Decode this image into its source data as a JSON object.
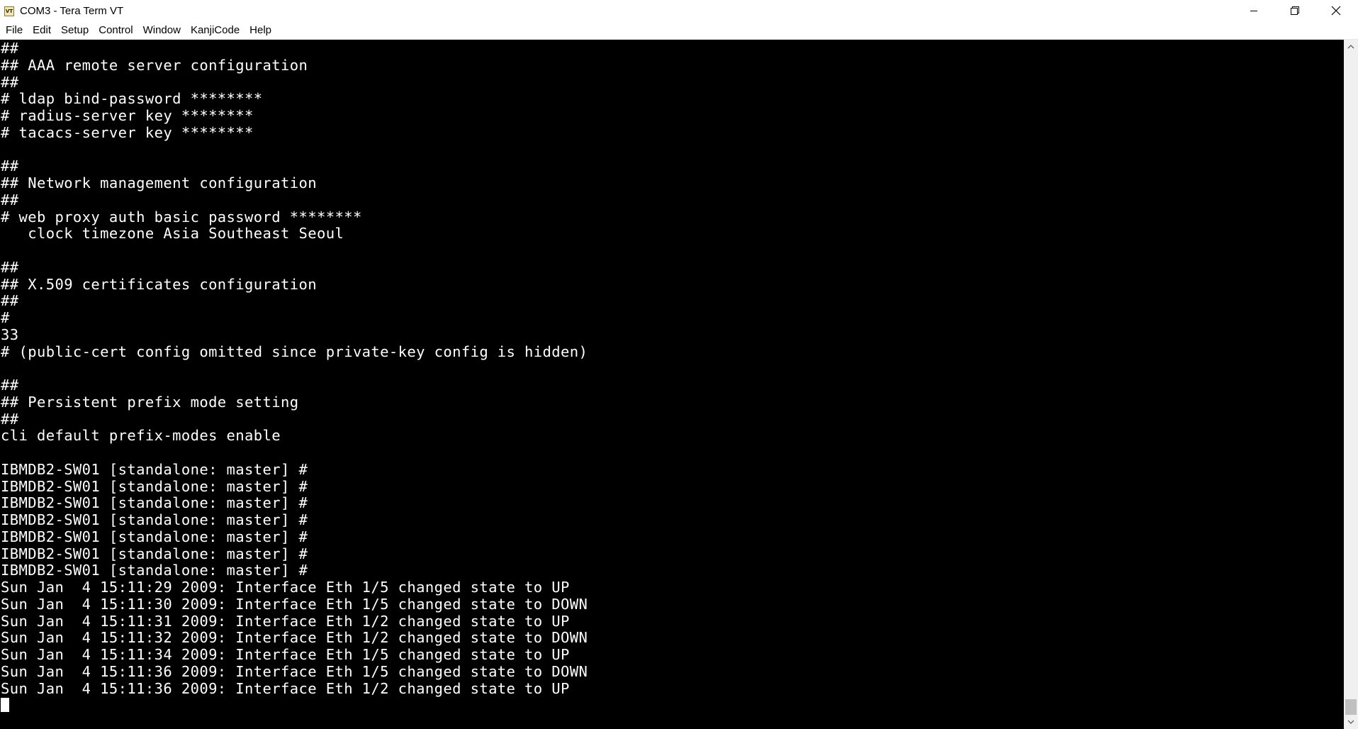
{
  "window": {
    "title": "COM3 - Tera Term VT",
    "app_icon_text": "VT"
  },
  "menu": {
    "items": [
      "File",
      "Edit",
      "Setup",
      "Control",
      "Window",
      "KanjiCode",
      "Help"
    ]
  },
  "terminal": {
    "lines": [
      "##",
      "## AAA remote server configuration",
      "##",
      "# ldap bind-password ********",
      "# radius-server key ********",
      "# tacacs-server key ********",
      "",
      "##",
      "## Network management configuration",
      "##",
      "# web proxy auth basic password ********",
      "   clock timezone Asia Southeast Seoul",
      "",
      "##",
      "## X.509 certificates configuration",
      "##",
      "#",
      "33",
      "# (public-cert config omitted since private-key config is hidden)",
      "",
      "##",
      "## Persistent prefix mode setting",
      "##",
      "cli default prefix-modes enable",
      "",
      "IBMDB2-SW01 [standalone: master] #",
      "IBMDB2-SW01 [standalone: master] #",
      "IBMDB2-SW01 [standalone: master] #",
      "IBMDB2-SW01 [standalone: master] #",
      "IBMDB2-SW01 [standalone: master] #",
      "IBMDB2-SW01 [standalone: master] #",
      "IBMDB2-SW01 [standalone: master] #",
      "Sun Jan  4 15:11:29 2009: Interface Eth 1/5 changed state to UP",
      "Sun Jan  4 15:11:30 2009: Interface Eth 1/5 changed state to DOWN",
      "Sun Jan  4 15:11:31 2009: Interface Eth 1/2 changed state to UP",
      "Sun Jan  4 15:11:32 2009: Interface Eth 1/2 changed state to DOWN",
      "Sun Jan  4 15:11:34 2009: Interface Eth 1/5 changed state to UP",
      "Sun Jan  4 15:11:36 2009: Interface Eth 1/5 changed state to DOWN",
      "Sun Jan  4 15:11:36 2009: Interface Eth 1/2 changed state to UP"
    ],
    "background_color": "#000000",
    "text_color": "#ffffff"
  },
  "icons": {
    "minimize": "minimize-icon",
    "maximize": "restore-icon",
    "close": "close-icon",
    "scroll_up": "arrow-up-icon",
    "scroll_down": "arrow-down-icon"
  }
}
